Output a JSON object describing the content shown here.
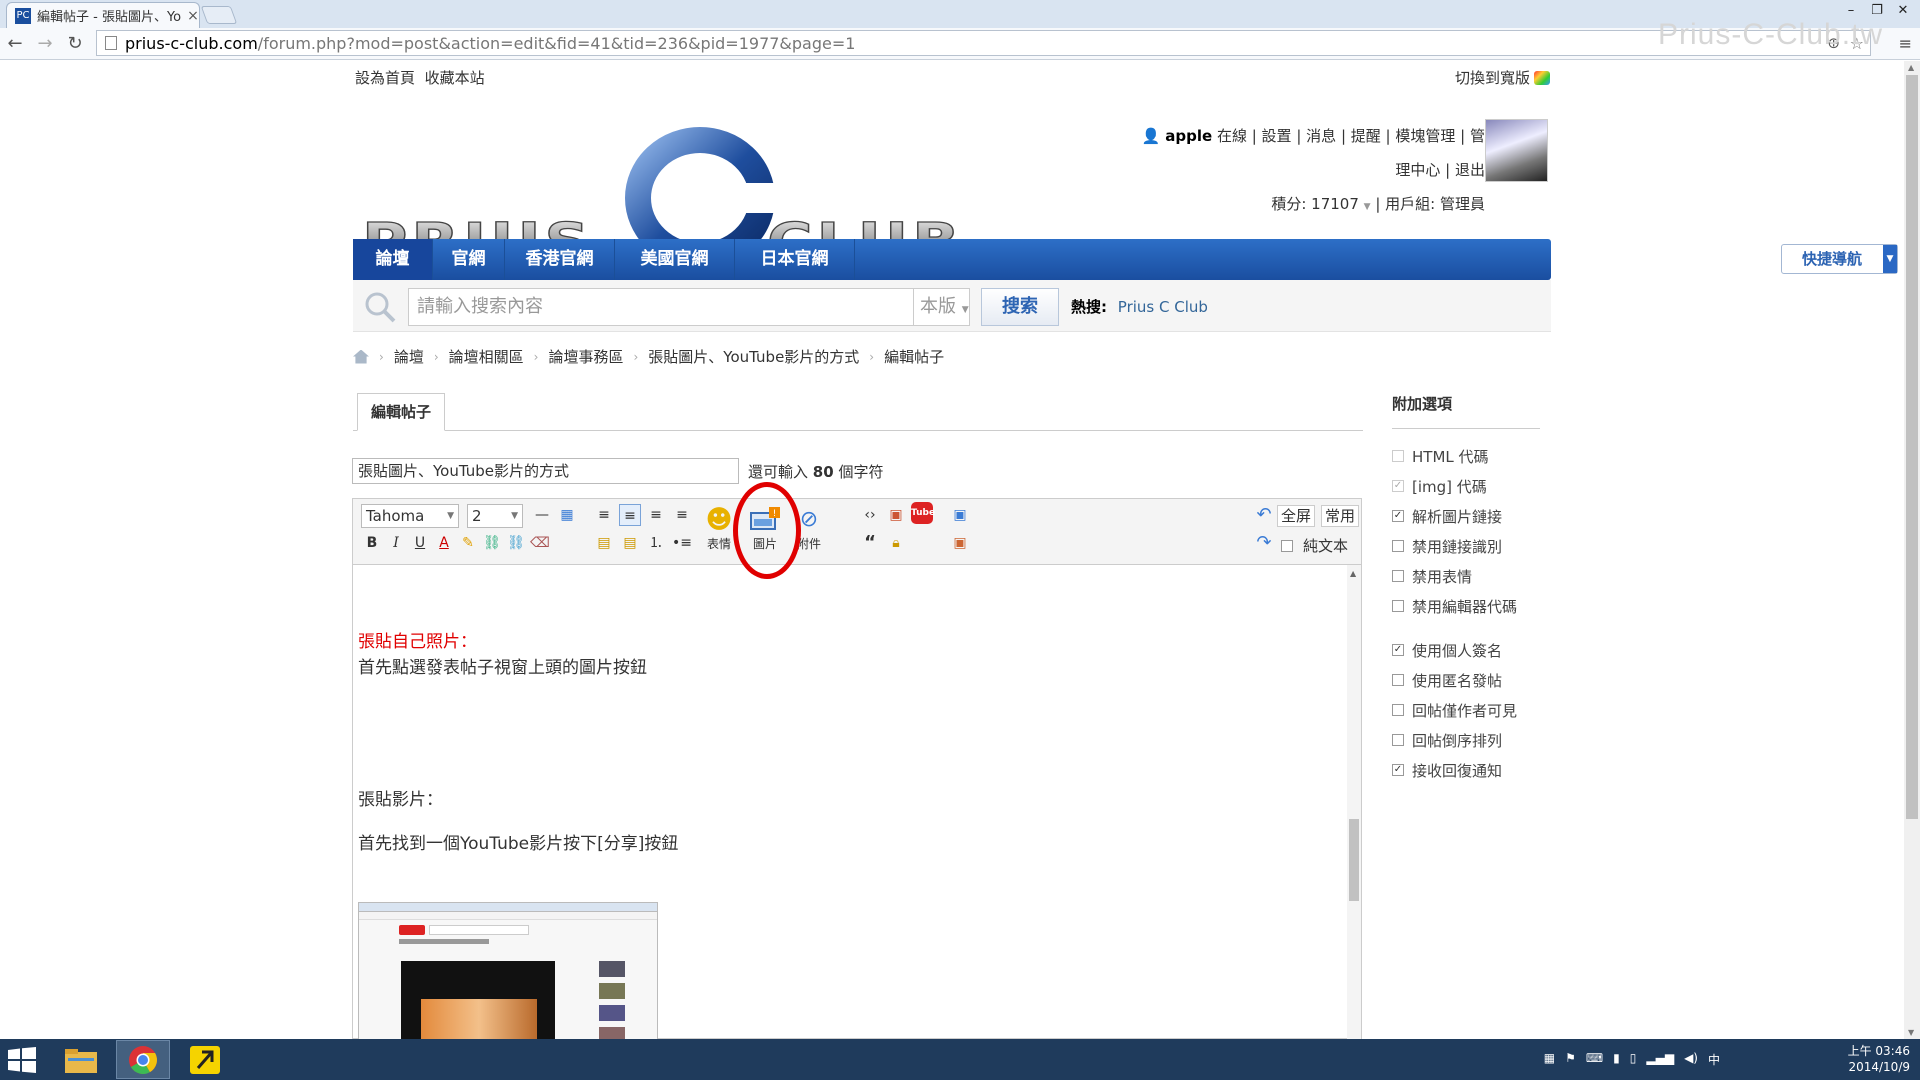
{
  "browser": {
    "tab_title": "編輯帖子 - 張貼圖片、Yo",
    "tab_close": "×",
    "url_domain": "prius-c-club.com",
    "url_path": "/forum.php?mod=post&action=edit&fid=41&tid=236&pid=1977&page=1",
    "window_min": "–",
    "window_restore": "❐",
    "window_close": "✕"
  },
  "watermark": "Prius-C-Club.tw",
  "topbar": {
    "set_home": "設為首頁",
    "bookmark": "收藏本站",
    "switch_wide": "切換到寬版"
  },
  "user": {
    "name": "apple",
    "online": "在線",
    "settings": "設置",
    "messages": "消息",
    "reminders": "提醒",
    "mod_manage": "模塊管理",
    "admin_a": "管",
    "admin_b": "理中心",
    "logout": "退出",
    "points": "積分: 17107",
    "group": "用戶組: 管理員"
  },
  "nav": {
    "items": [
      "論壇",
      "官網",
      "香港官網",
      "美國官網",
      "日本官網"
    ],
    "quicknav": "快捷導航"
  },
  "search": {
    "placeholder": "請輸入搜索內容",
    "scope": "本版",
    "button": "搜索",
    "hot_label": "熱搜:",
    "hot_item": "Prius C Club"
  },
  "breadcrumb": [
    "論壇",
    "論壇相關區",
    "論壇事務區",
    "張貼圖片、YouTube影片的方式",
    "編輯帖子"
  ],
  "editor": {
    "tab": "編輯帖子",
    "subject": "張貼圖片、YouTube影片的方式",
    "hint_pre": "還可輸入",
    "hint_num": "80",
    "hint_post": "個字符",
    "font": "Tahoma",
    "size": "2",
    "emoji_label": "表情",
    "image_label": "圖片",
    "attach_label": "附件",
    "fullscreen": "全屏",
    "common": "常用",
    "plaintext": "純文本",
    "content": {
      "h1": "張貼自己照片：",
      "p1": "首先點選發表帖子視窗上頭的圖片按鈕",
      "h2": "張貼影片：",
      "p2": "首先找到一個YouTube影片按下[分享]按鈕"
    }
  },
  "sidebar": {
    "title": "附加選項",
    "options": [
      {
        "label": "HTML 代碼",
        "checked": false,
        "disabled": true
      },
      {
        "label": "[img] 代碼",
        "checked": true,
        "disabled": true
      },
      {
        "label": "解析圖片鏈接",
        "checked": true,
        "disabled": false
      },
      {
        "label": "禁用鏈接識別",
        "checked": false,
        "disabled": false
      },
      {
        "label": "禁用表情",
        "checked": false,
        "disabled": false
      },
      {
        "label": "禁用編輯器代碼",
        "checked": false,
        "disabled": false
      }
    ],
    "options2": [
      {
        "label": "使用個人簽名",
        "checked": true
      },
      {
        "label": "使用匿名發帖",
        "checked": false
      },
      {
        "label": "回帖僅作者可見",
        "checked": false
      },
      {
        "label": "回帖倒序排列",
        "checked": false
      },
      {
        "label": "接收回復通知",
        "checked": true
      }
    ]
  },
  "taskbar": {
    "ime": "中",
    "time": "上午 03:46",
    "date": "2014/10/9"
  },
  "colors": {
    "nav_blue": "#1a4ea0",
    "accent_red": "#e00000",
    "link_blue": "#336699"
  }
}
